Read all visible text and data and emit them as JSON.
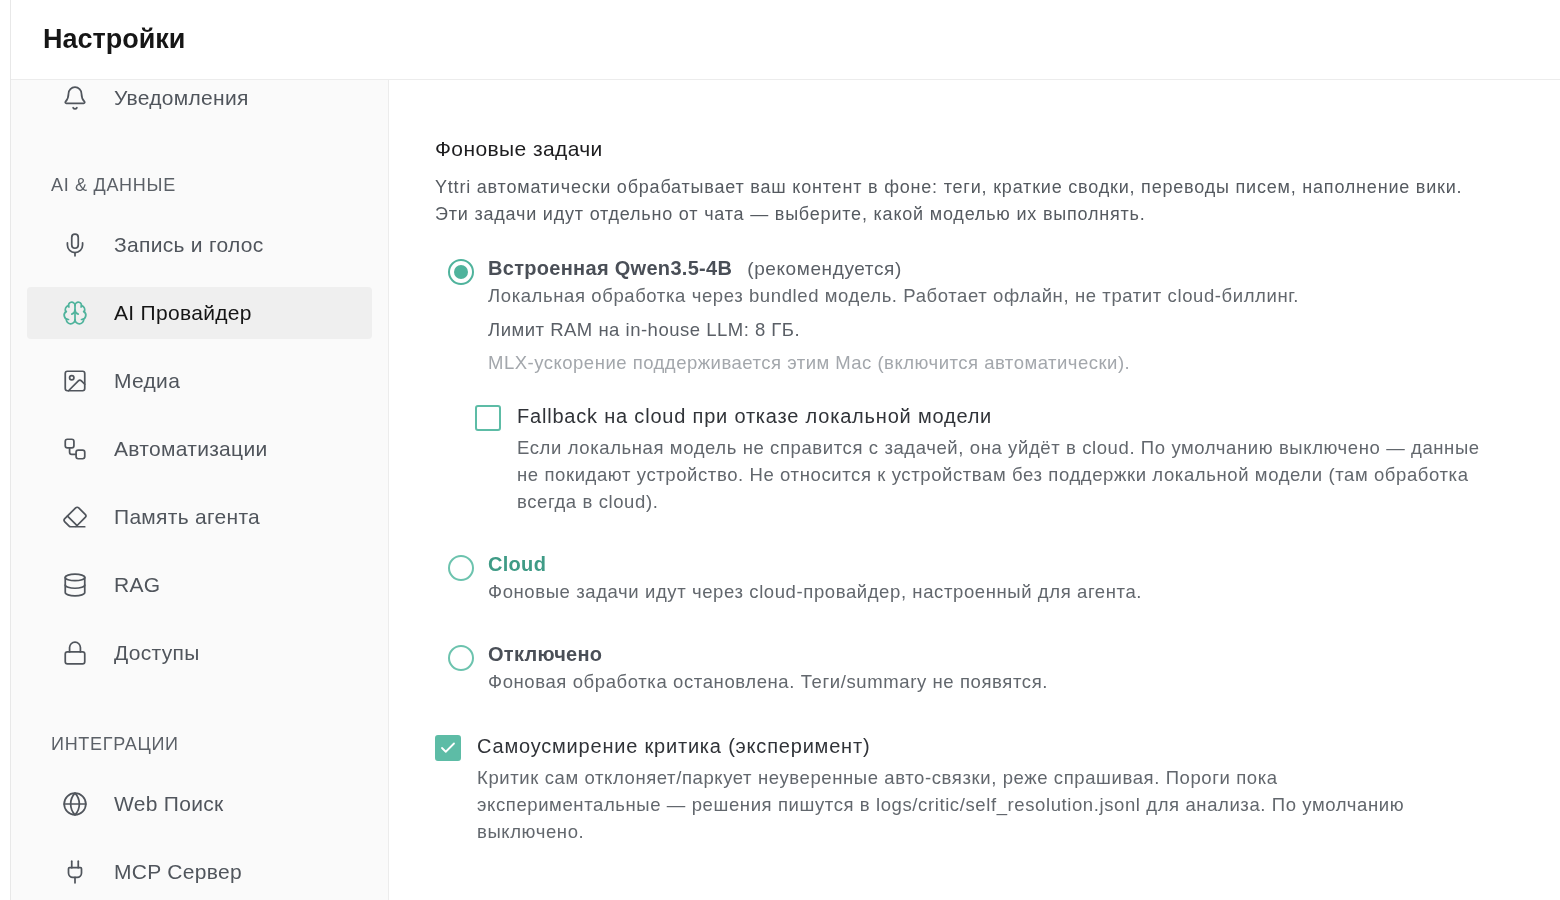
{
  "header": {
    "title": "Настройки"
  },
  "sidebar": {
    "sections": [
      {
        "items": [
          {
            "label": "Уведомления",
            "selected": false
          }
        ]
      },
      {
        "title": "AI & ДАННЫЕ",
        "items": [
          {
            "label": "Запись и голос",
            "selected": false
          },
          {
            "label": "AI Провайдер",
            "selected": true
          },
          {
            "label": "Медиа",
            "selected": false
          },
          {
            "label": "Автоматизации",
            "selected": false
          },
          {
            "label": "Память агента",
            "selected": false
          },
          {
            "label": "RAG",
            "selected": false
          },
          {
            "label": "Доступы",
            "selected": false
          }
        ]
      },
      {
        "title": "ИНТЕГРАЦИИ",
        "items": [
          {
            "label": "Web Поиск",
            "selected": false
          },
          {
            "label": "MCP Сервер",
            "selected": false
          }
        ]
      }
    ]
  },
  "section": {
    "title": "Фоновые задачи",
    "description": "Yttri автоматически обрабатывает ваш контент в фоне: теги, краткие сводки, переводы писем, наполнение вики. Эти задачи идут отдельно от чата — выберите, какой моделью их выполнять.",
    "options": [
      {
        "title": "Встроенная Qwen3.5-4B",
        "note": "(рекомендуется)",
        "selected": true,
        "hovered": false,
        "description": "Локальная обработка через bundled модель. Работает офлайн, не тратит cloud-биллинг.",
        "details": [
          {
            "kind": "text",
            "text": "Лимит RAM на in-house LLM: 8 ГБ."
          },
          {
            "kind": "hint",
            "text": "MLX-ускорение поддерживается этим Mac (включится автоматически)."
          }
        ],
        "fallback": {
          "label": "Fallback на cloud при отказе локальной модели",
          "checked": false,
          "description": "Если локальная модель не справится с задачей, она уйдёт в cloud. По умолчанию выключено — данные не покидают устройство. Не относится к устройствам без поддержки локальной модели (там обработка всегда в cloud)."
        }
      },
      {
        "title": "Cloud",
        "selected": false,
        "hovered": true,
        "description": "Фоновые задачи идут через cloud-провайдер, настроенный для агента."
      },
      {
        "title": "Отключено",
        "selected": false,
        "hovered": false,
        "description": "Фоновая обработка остановлена. Теги/summary не появятся."
      }
    ],
    "critic": {
      "label": "Самоусмирение критика (эксперимент)",
      "checked": true,
      "description": "Критик сам отклоняет/паркует неуверенные авто-связки, реже спрашивая. Пороги пока экспериментальные — решения пишутся в logs/critic/self_resolution.jsonl для анализа. По умолчанию выключено."
    }
  }
}
